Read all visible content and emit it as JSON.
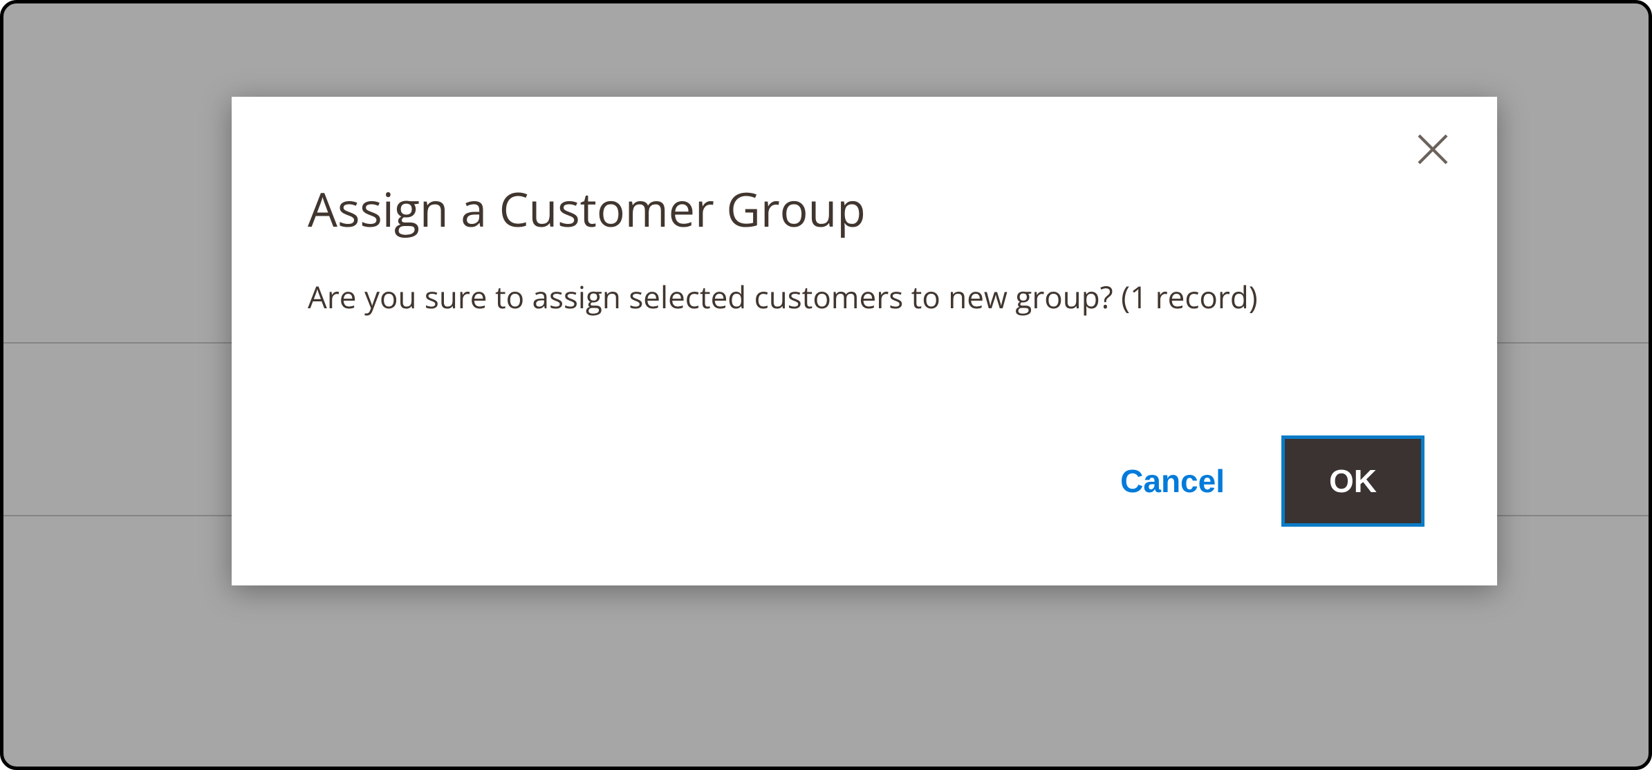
{
  "modal": {
    "title": "Assign a Customer Group",
    "message": "Are you sure to assign selected customers to new group? (1 record)",
    "cancel_label": "Cancel",
    "ok_label": "OK"
  }
}
